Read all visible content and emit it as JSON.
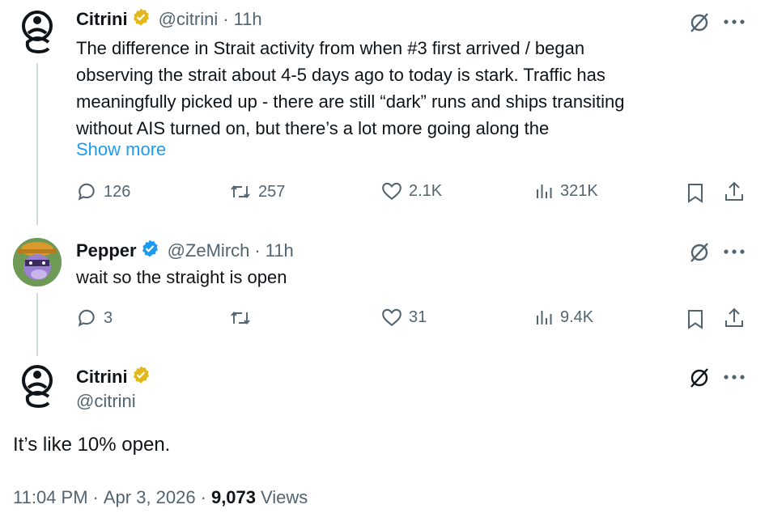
{
  "tweets": [
    {
      "author_name": "Citrini",
      "handle": "@citrini",
      "separator": "·",
      "time": "11h",
      "lines": [
        "The difference in Strait activity from when #3 first arrived / began",
        "observing the strait about 4-5 days ago to today is stark. Traffic has",
        "meaningfully picked up - there are still “dark” runs and ships transiting",
        "without AIS turned on, but there’s a lot more going along the"
      ],
      "show_more": "Show more",
      "replies": "126",
      "reposts": "257",
      "likes": "2.1K",
      "views": "321K"
    },
    {
      "author_name": "Pepper",
      "handle": "@ZeMirch",
      "separator": "·",
      "time": "11h",
      "text": "wait so the straight is open",
      "replies": "3",
      "reposts": "",
      "likes": "31",
      "views": "9.4K"
    }
  ],
  "main_tweet": {
    "author_name": "Citrini",
    "handle": "@citrini",
    "text": "It’s like 10% open.",
    "time": "11:04 PM",
    "date": "Apr 3, 2026",
    "separator": "·",
    "views_count": "9,073",
    "views_label": "Views"
  },
  "colors": {
    "accent": "#1d9bf0",
    "gold_badge": "#e2b719",
    "blue_badge": "#1d9bf0",
    "muted": "#536471",
    "thread_line": "#cfd9de"
  },
  "icons": [
    "grok-icon",
    "more-icon",
    "reply-icon",
    "repost-icon",
    "like-icon",
    "views-icon",
    "bookmark-icon",
    "share-icon",
    "verified-badge-icon"
  ]
}
